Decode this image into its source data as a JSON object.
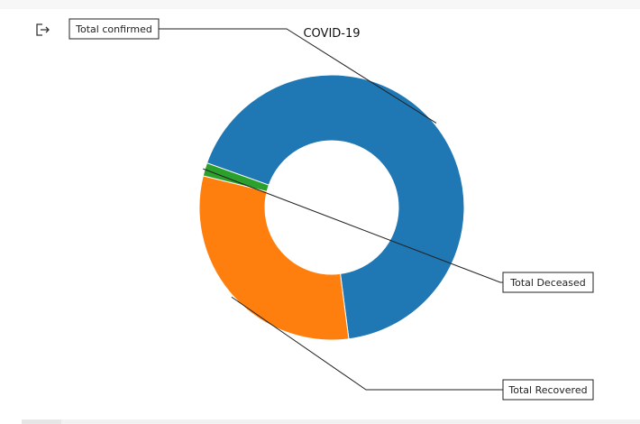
{
  "chart_data": {
    "type": "pie",
    "title": "COVID-19",
    "donut": true,
    "labels": [
      "Total confirmed",
      "Total Recovered",
      "Total Deceased"
    ],
    "values": [
      67.5,
      30.9,
      1.6
    ],
    "colors": [
      "#1f77b4",
      "#ff7f0e",
      "#2ca02c"
    ]
  },
  "toolbar": {
    "output_icon": "output-expand-icon"
  }
}
